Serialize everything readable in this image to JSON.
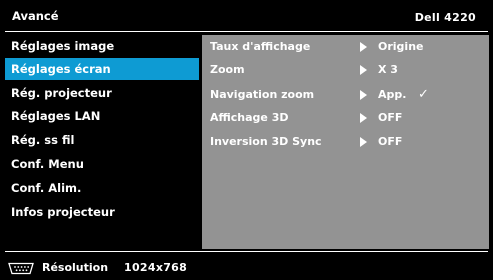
{
  "header": {
    "title": "Avancé",
    "model": "Dell 4220"
  },
  "sidebar": {
    "items": [
      {
        "label": "Réglages image",
        "selected": false
      },
      {
        "label": "Réglages écran",
        "selected": true
      },
      {
        "label": "Rég. projecteur",
        "selected": false
      },
      {
        "label": "Réglages LAN",
        "selected": false
      },
      {
        "label": "Rég. ss fil",
        "selected": false
      },
      {
        "label": "Conf. Menu",
        "selected": false
      },
      {
        "label": "Conf. Alim.",
        "selected": false
      },
      {
        "label": "Infos projecteur",
        "selected": false
      }
    ]
  },
  "settings": {
    "rows": [
      {
        "label": "Taux d'affichage",
        "value": "Origine",
        "check": ""
      },
      {
        "label": "Zoom",
        "value": "X 3",
        "check": ""
      },
      {
        "label": "Navigation zoom",
        "value": "App.",
        "check": "✓"
      },
      {
        "label": "Affichage 3D",
        "value": "OFF",
        "check": ""
      },
      {
        "label": "Inversion 3D Sync",
        "value": "OFF",
        "check": ""
      }
    ]
  },
  "footer": {
    "icon": "vga-input-icon",
    "label": "Résolution",
    "value": "1024x768"
  },
  "colors": {
    "selected": "#0e9bd3",
    "panel": "#939393",
    "background": "#000000"
  }
}
